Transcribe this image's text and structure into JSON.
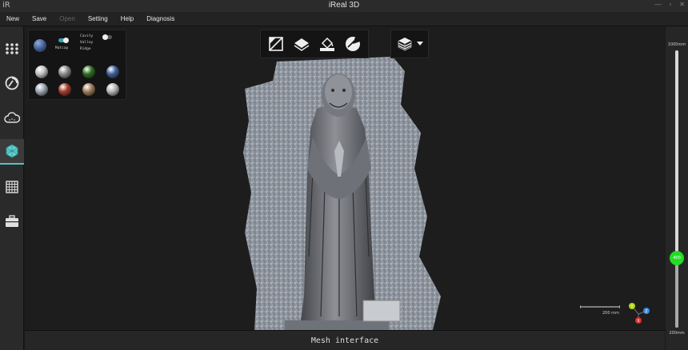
{
  "window": {
    "logo": "iR",
    "title": "iReal 3D",
    "controls": [
      "—",
      "▫",
      "✕"
    ]
  },
  "menu": [
    {
      "label": "New",
      "enabled": true
    },
    {
      "label": "Save",
      "enabled": true
    },
    {
      "label": "Open",
      "enabled": false
    },
    {
      "label": "Setting",
      "enabled": true
    },
    {
      "label": "Help",
      "enabled": true
    },
    {
      "label": "Diagnosis",
      "enabled": true
    }
  ],
  "sidebar": {
    "items": [
      {
        "name": "scan-icon",
        "active": false
      },
      {
        "name": "rotate-icon",
        "active": false
      },
      {
        "name": "cloud-icon",
        "active": false
      },
      {
        "name": "mesh-icon",
        "active": true
      },
      {
        "name": "grid-icon",
        "active": false
      },
      {
        "name": "toolbox-icon",
        "active": false
      }
    ]
  },
  "material_panel": {
    "matcap_label": "Matcap",
    "options_text": "Cavity\nValley\nRidge",
    "matcap_on": true,
    "cavity_on": false,
    "spheres": [
      "#c0c0c0",
      "#8a8a8a",
      "#2c6e1f",
      "#3e5f9a",
      "#9aa4b0",
      "#a33a2a",
      "#a07a5a",
      "#b5b5b5"
    ]
  },
  "toolbar": {
    "tools": [
      "crop-icon",
      "layers-icon",
      "paint-fill-icon",
      "pie-icon"
    ],
    "view_menu": "layers-cube-icon"
  },
  "scale": {
    "label": "200 mm"
  },
  "axes": {
    "y": "Y",
    "z": "Z",
    "x": "X"
  },
  "status": {
    "text": "Mesh interface"
  },
  "depth_slider": {
    "top_label": "1000mm",
    "bottom_label": "200mm",
    "value_label": "400",
    "value_fraction": 0.25
  }
}
